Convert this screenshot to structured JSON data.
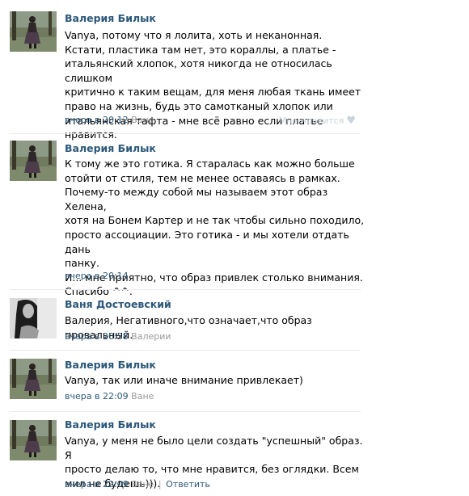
{
  "comments": [
    {
      "author": "Валерия Билык",
      "text": "Vanya, потому что я лолита, хоть и неканонная.\nКстати, пластика там нет, это кораллы, а платье -\nитальянский хлопок, хотя никогда не относилась слишком\nкритично к таким вещам, для меня любая ткань имеет\nправо на жизнь, будь это самотканый хлопок или\nитальянская тафта - мне всё равно если платье нравится.",
      "date": "вчера в 20:12",
      "reply_to": "Ване",
      "like_label": "Мне нравится",
      "like_icon": "heart-icon"
    },
    {
      "author": "Валерия Билык",
      "text": "К тому же это готика. Я старалась как можно больше\nотойти от стиля, тем не менее оставаясь в рамках.\nПочему-то между собой мы называем этот образ Хелена,\nхотя на Бонем Картер и не так чтобы сильно походило,\nпросто ассоциации. Это готика - и мы хотели отдать дань\nпанку.\nИ... мне приятно, что образ привлек столько внимания.\nСпасибо ^^.",
      "date": "вчера в 20:14"
    },
    {
      "author": "Ваня Достоевский",
      "text": "Валерия, Негативного,что означает,что образ провальный.",
      "date": "вчера в 20:58",
      "reply_to": "Валерии"
    },
    {
      "author": "Валерия Билык",
      "text": "Vanya, так или иначе внимание привлекает)",
      "date": "вчера в 22:09",
      "reply_to": "Ване"
    },
    {
      "author": "Валерия Билык",
      "text": "Vanya, у меня не было цели создать \"успешный\" образ. Я\nпросто делаю то, что мне нравится, без оглядки. Всем\nмил не будешь))).",
      "date": "вчера в 22:09",
      "reply_to": "Ване",
      "action_label": "Ответить"
    }
  ],
  "colors": {
    "author": "#2b587a",
    "meta": "#999999",
    "like": "#c9d3dc",
    "divider": "#e7ebf0"
  }
}
